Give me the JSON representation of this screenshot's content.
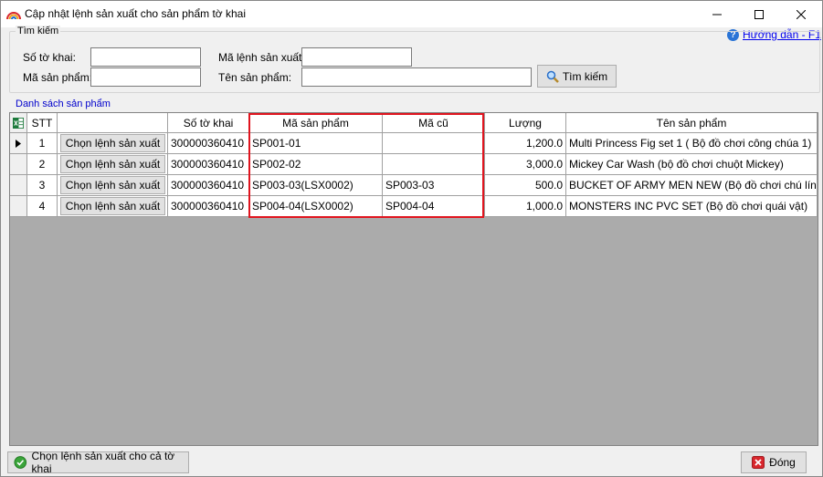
{
  "window": {
    "title": "Cập nhật lệnh sản xuất cho sản phẩm tờ khai",
    "minimize_icon": "minimize-icon",
    "maximize_icon": "maximize-icon",
    "close_icon": "close-icon"
  },
  "help": {
    "icon": "question-icon",
    "label": "Hướng dẫn - F1"
  },
  "search": {
    "group_title": "Tìm kiếm",
    "so_to_khai_label": "Số tờ khai:",
    "so_to_khai_value": "",
    "ma_lenh_label": "Mã lệnh sản xuất:",
    "ma_lenh_value": "",
    "ma_san_pham_label": "Mã sản phẩm:",
    "ma_san_pham_value": "",
    "ten_san_pham_label": "Tên sản phẩm:",
    "ten_san_pham_value": "",
    "search_button": "Tìm kiếm"
  },
  "list": {
    "title": "Danh sách sản phẩm",
    "columns": [
      "STT",
      "",
      "Số tờ khai",
      "Mã sản phẩm",
      "Mã cũ",
      "Lượng",
      "Tên sản phẩm"
    ],
    "rows": [
      {
        "stt": "1",
        "action": "Chọn lệnh sản xuất",
        "so_to_khai": "300000360410",
        "ma_san_pham": "SP001-01",
        "ma_cu": "",
        "luong": "1,200.0",
        "ten_san_pham": "Multi Princess Fig set 1 ( Bộ đồ chơi công chúa 1)"
      },
      {
        "stt": "2",
        "action": "Chọn lệnh sản xuất",
        "so_to_khai": "300000360410",
        "ma_san_pham": "SP002-02",
        "ma_cu": "",
        "luong": "3,000.0",
        "ten_san_pham": "Mickey Car Wash (bộ đồ chơi chuột Mickey)"
      },
      {
        "stt": "3",
        "action": "Chọn lệnh sản xuất",
        "so_to_khai": "300000360410",
        "ma_san_pham": "SP003-03(LSX0002)",
        "ma_cu": "SP003-03",
        "luong": "500.0",
        "ten_san_pham": "BUCKET OF ARMY MEN NEW (Bộ đồ chơi chú lính)"
      },
      {
        "stt": "4",
        "action": "Chọn lệnh sản xuất",
        "so_to_khai": "300000360410",
        "ma_san_pham": "SP004-04(LSX0002)",
        "ma_cu": "SP004-04",
        "luong": "1,000.0",
        "ten_san_pham": "MONSTERS INC PVC SET (Bộ đồ chơi quái vật)"
      }
    ]
  },
  "footer": {
    "select_all_button": "Chọn lệnh sản xuất cho cả tờ khai",
    "close_button": "Đóng"
  },
  "colors": {
    "highlight": "#e0141e",
    "link": "#0000ee",
    "group_title": "#0000cc"
  }
}
